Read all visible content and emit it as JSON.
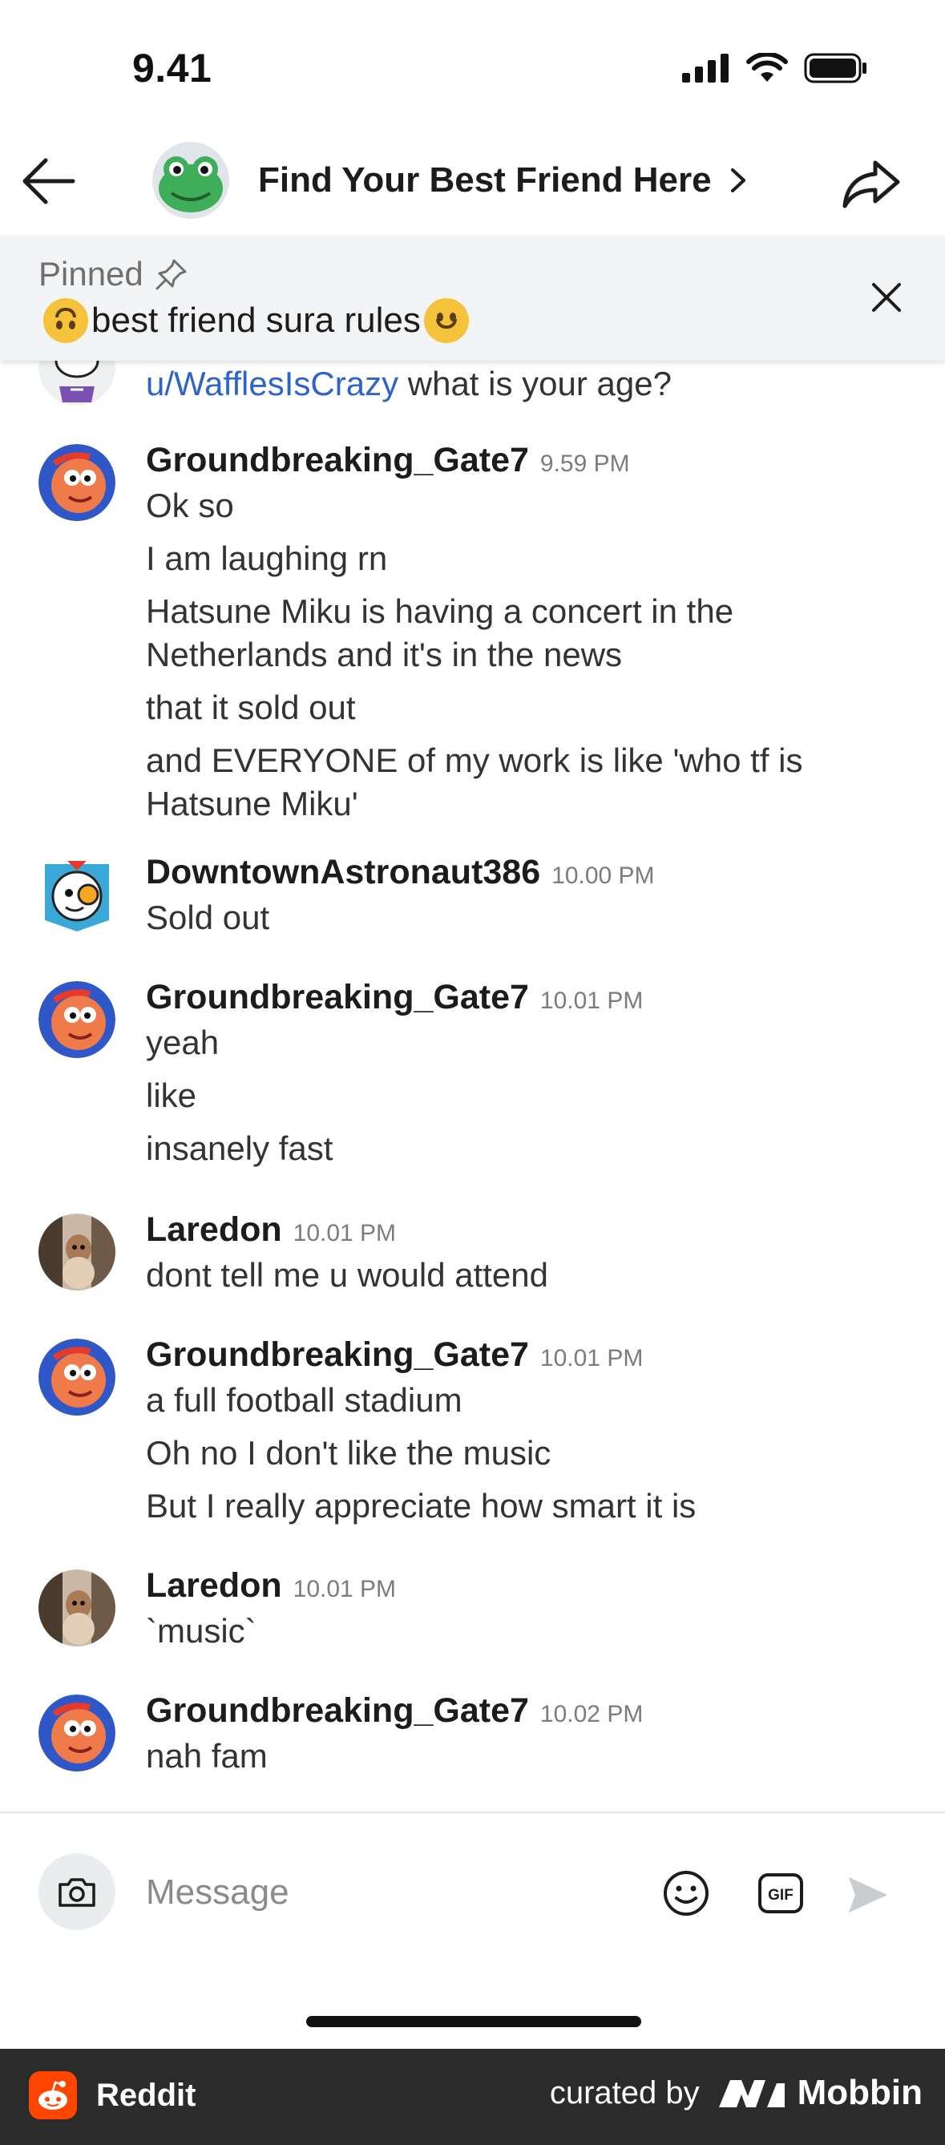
{
  "status_bar": {
    "time": "9.41"
  },
  "header": {
    "title": "Find Your Best Friend Here"
  },
  "pinned": {
    "label": "Pinned",
    "text": "best friend sura rules"
  },
  "partial_message": {
    "mention": "u/WafflesIsCrazy",
    "text": " what is your age?"
  },
  "groups": [
    {
      "author": "Groundbreaking_Gate7",
      "time": "9.59 PM",
      "lines": [
        "Ok so",
        "I am laughing rn",
        "Hatsune Miku is having a concert in the Netherlands and it's in the news",
        "that it sold out",
        "and EVERYONE of my work is like 'who tf is Hatsune Miku'"
      ]
    },
    {
      "author": "DowntownAstronaut386",
      "time": "10.00 PM",
      "lines": [
        "Sold out"
      ]
    },
    {
      "author": "Groundbreaking_Gate7",
      "time": "10.01 PM",
      "lines": [
        "yeah",
        "like",
        "insanely fast"
      ]
    },
    {
      "author": "Laredon",
      "time": "10.01 PM",
      "lines": [
        "dont tell me u would attend"
      ]
    },
    {
      "author": "Groundbreaking_Gate7",
      "time": "10.01 PM",
      "lines": [
        "a full football stadium",
        "Oh no I don't like the music",
        "But I really appreciate how smart it is"
      ]
    },
    {
      "author": "Laredon",
      "time": "10.01 PM",
      "lines": [
        "`music`"
      ]
    },
    {
      "author": "Groundbreaking_Gate7",
      "time": "10.02 PM",
      "lines": [
        "nah fam"
      ]
    }
  ],
  "composer": {
    "placeholder": "Message",
    "gif_label": "GIF"
  },
  "footer": {
    "brand": "Reddit",
    "curated": "curated by",
    "mobbin": "Mobbin"
  },
  "colors": {
    "mention": "#2e64c9",
    "reddit_orange": "#ff4500",
    "pinned_bg": "#f2f4f5",
    "footer_bg": "#2b2b2b"
  }
}
